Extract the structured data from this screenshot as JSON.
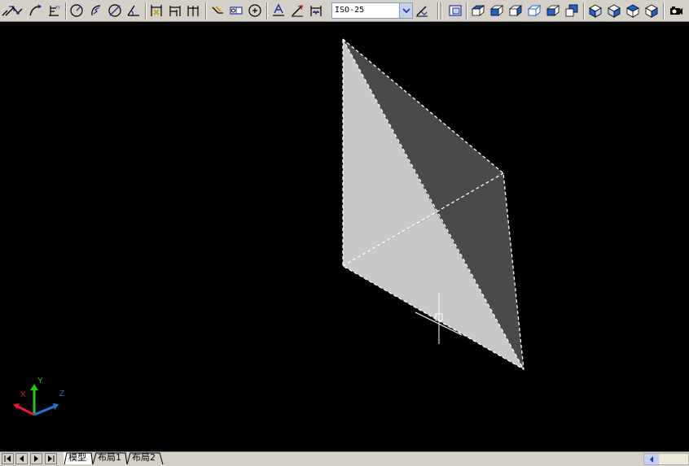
{
  "toolbar": {
    "dim_style": "ISO-25",
    "tools_left": [
      "dim-aligned-icon",
      "dim-arc-icon",
      "dim-ordinate-icon",
      "dim-radius-icon",
      "dim-jogged-icon",
      "dim-diameter-icon",
      "dim-angular-icon",
      "quick-dim-icon",
      "dim-baseline-icon",
      "dim-continue-icon",
      "quick-leader-icon",
      "tolerance-icon",
      "center-mark-icon",
      "dim-edit-icon",
      "dim-text-edit-icon",
      "dim-update-icon",
      "dim-style-icon"
    ],
    "tools_right": [
      "named-views-icon",
      "top-view-icon",
      "bottom-view-icon",
      "left-view-icon",
      "right-view-icon",
      "front-view-icon",
      "back-view-icon",
      "sw-iso-icon",
      "se-iso-icon",
      "ne-iso-icon",
      "nw-iso-icon",
      "camera-icon"
    ]
  },
  "viewport": {
    "background": "#000000",
    "shade_light": "#c8c8c8",
    "shade_dark": "#4a4a4a",
    "ucs": {
      "x_label": "X",
      "y_label": "Y",
      "z_label": "Z",
      "x_color": "#e8192c",
      "y_color": "#1ec81e",
      "z_color": "#1e78dc"
    }
  },
  "tabs": {
    "items": [
      "模型",
      "布局1",
      "布局2"
    ],
    "active": "模型"
  }
}
